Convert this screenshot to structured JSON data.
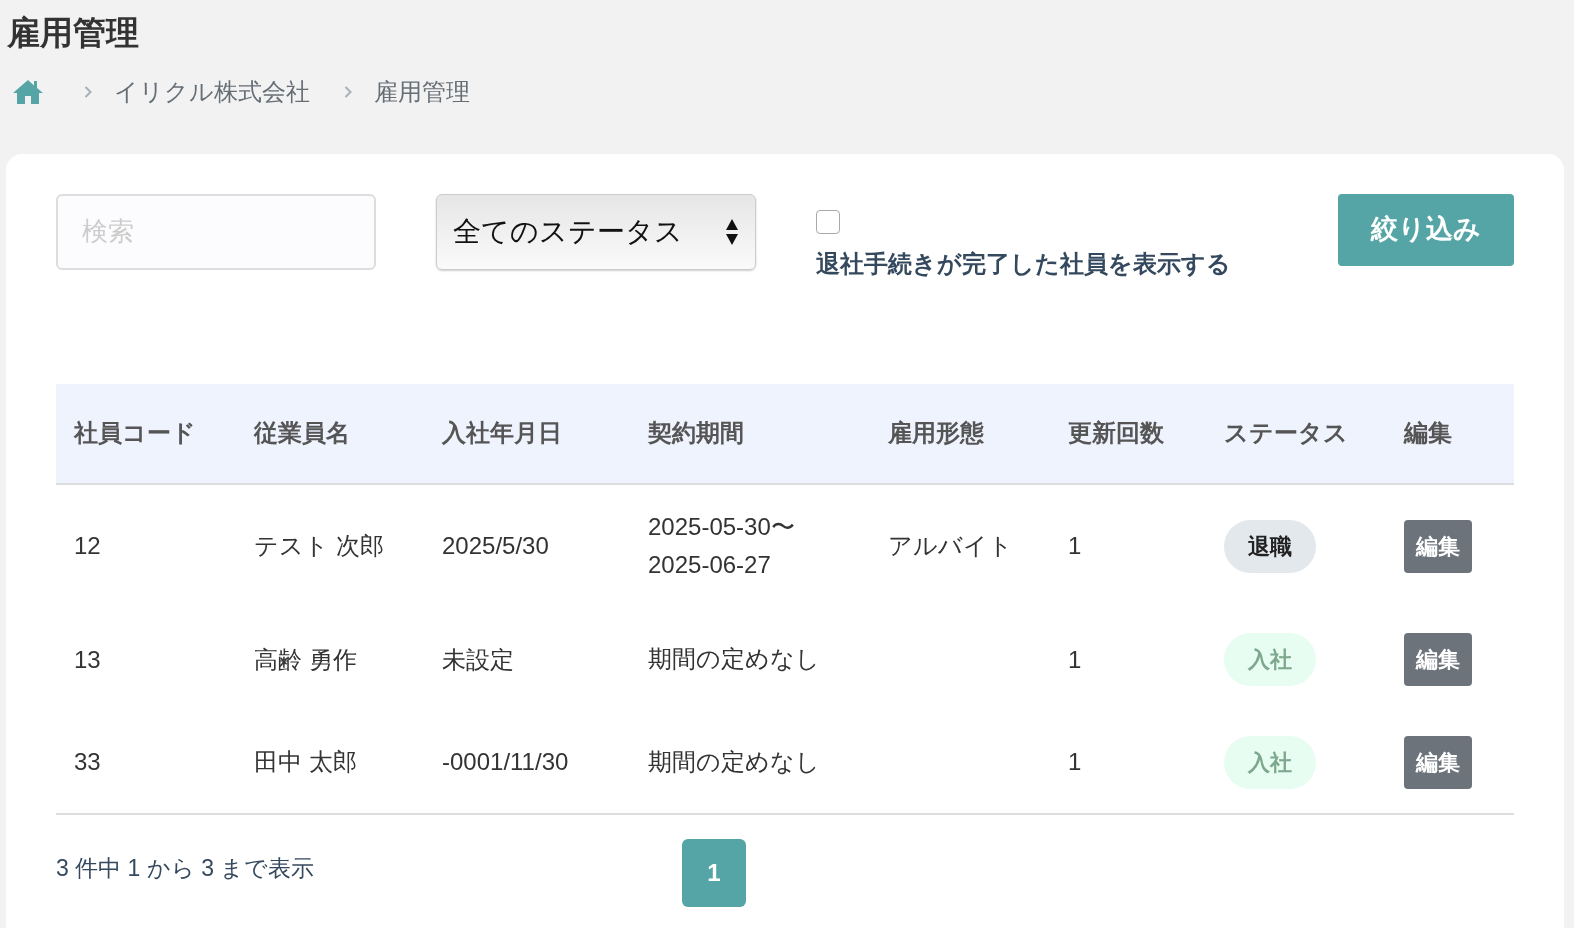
{
  "page_title": "雇用管理",
  "breadcrumb": [
    {
      "label": "イリクル株式会社"
    },
    {
      "label": "雇用管理"
    }
  ],
  "filters": {
    "search": {
      "placeholder": "検索"
    },
    "status_select": {
      "value": "全てのステータス"
    },
    "show_retired": {
      "label": "退社手続きが完了した社員を表示する",
      "checked": false
    },
    "filter_button": "絞り込み"
  },
  "table": {
    "columns": [
      "社員コード",
      "従業員名",
      "入社年月日",
      "契約期間",
      "雇用形態",
      "更新回数",
      "ステータス",
      "編集"
    ],
    "rows": [
      {
        "code": "12",
        "name": "テスト 次郎",
        "hire_date": "2025/5/30",
        "contract": [
          "2025-05-30〜",
          "2025-06-27"
        ],
        "employment_type": "アルバイト",
        "renewals": "1",
        "status": {
          "label": "退職",
          "kind": "retired"
        },
        "edit": "編集"
      },
      {
        "code": "13",
        "name": "高齢 勇作",
        "hire_date": "未設定",
        "contract": [
          "期間の定めなし"
        ],
        "renewals": "1",
        "status": {
          "label": "入社",
          "kind": "joined"
        },
        "edit": "編集"
      },
      {
        "code": "33",
        "name": "田中 太郎",
        "hire_date": "-0001/11/30",
        "contract": [
          "期間の定めなし"
        ],
        "renewals": "1",
        "status": {
          "label": "入社",
          "kind": "joined"
        },
        "edit": "編集"
      }
    ]
  },
  "footer": {
    "info": "3 件中 1 から 3 まで表示",
    "pages": [
      {
        "label": "1",
        "selected": true
      }
    ]
  }
}
